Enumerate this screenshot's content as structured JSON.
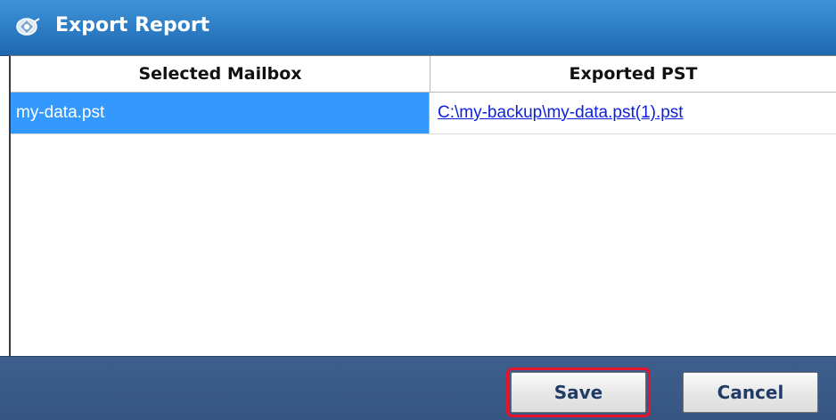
{
  "window": {
    "title": "Export Report",
    "icon": "export-report-app-icon"
  },
  "grid": {
    "columns": [
      "Selected Mailbox",
      "Exported PST"
    ],
    "rows": [
      {
        "selected_mailbox": "my-data.pst",
        "exported_pst": "C:\\my-backup\\my-data.pst(1).pst",
        "selected": true
      }
    ]
  },
  "footer": {
    "save_label": "Save",
    "cancel_label": "Cancel",
    "highlighted_button": "save"
  },
  "colors": {
    "title_bar": "#2f80c8",
    "selection": "#3399ff",
    "link": "#0b1fe0",
    "footer": "#3a5a88",
    "highlight_outline": "#e8122a"
  }
}
